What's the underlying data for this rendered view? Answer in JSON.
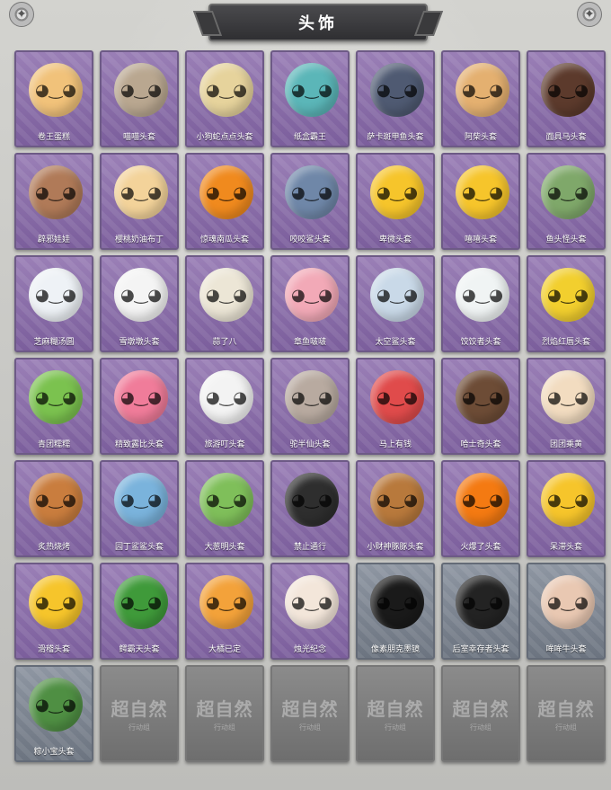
{
  "header": {
    "title": "头饰"
  },
  "icons": {
    "corner_left": "rune-icon",
    "corner_right": "rune-icon"
  },
  "items": [
    {
      "label": "卷王蛋糕",
      "icon": "cake-roll-icon",
      "color": "#f1c27a",
      "frame": "purple"
    },
    {
      "label": "喵喵头套",
      "icon": "cat-icon",
      "color": "#b9a790",
      "frame": "purple"
    },
    {
      "label": "小狗蛇点点头套",
      "icon": "snake-dog-icon",
      "color": "#e6d39c",
      "frame": "purple"
    },
    {
      "label": "纸盒霸王",
      "icon": "dino-box-icon",
      "color": "#5bb6b8",
      "frame": "purple"
    },
    {
      "label": "萨卡斑甲鱼头套",
      "icon": "fish-icon",
      "color": "#4f5a72",
      "frame": "purple"
    },
    {
      "label": "阿柴头套",
      "icon": "shiba-icon",
      "color": "#e4b070",
      "frame": "purple"
    },
    {
      "label": "面具马头套",
      "icon": "horse-icon",
      "color": "#5c3a2c",
      "frame": "purple"
    },
    {
      "label": "辟邪娃娃",
      "icon": "doll-icon",
      "color": "#b07a58",
      "frame": "purple"
    },
    {
      "label": "樱桃奶油布丁",
      "icon": "pudding-icon",
      "color": "#f3d39a",
      "frame": "purple"
    },
    {
      "label": "惊魂南瓜头套",
      "icon": "pumpkin-icon",
      "color": "#f08a1e",
      "frame": "purple"
    },
    {
      "label": "咬咬鲨头套",
      "icon": "shark-icon",
      "color": "#6f87a8",
      "frame": "purple"
    },
    {
      "label": "卑微头套",
      "icon": "emoji-icon",
      "color": "#f6c52b",
      "frame": "purple"
    },
    {
      "label": "嘻嘻头套",
      "icon": "emoji-grin-icon",
      "color": "#f6c52b",
      "frame": "purple"
    },
    {
      "label": "鱼头怪头套",
      "icon": "fishhead-icon",
      "color": "#7fa86a",
      "frame": "purple"
    },
    {
      "label": "芝麻糊汤圆",
      "icon": "dumpling-icon",
      "color": "#eef2f6",
      "frame": "purple"
    },
    {
      "label": "雪墩墩头套",
      "icon": "snowman-icon",
      "color": "#f4f4f4",
      "frame": "purple"
    },
    {
      "label": "蒜了八",
      "icon": "garlic-icon",
      "color": "#ece6d6",
      "frame": "purple"
    },
    {
      "label": "章鱼啵啵",
      "icon": "octopus-icon",
      "color": "#f2a9b7",
      "frame": "purple"
    },
    {
      "label": "太空鲨头套",
      "icon": "space-shark-icon",
      "color": "#c9d9e8",
      "frame": "purple"
    },
    {
      "label": "饺饺者头套",
      "icon": "cloud-icon",
      "color": "#f0f4f4",
      "frame": "purple"
    },
    {
      "label": "烈焰红唇头套",
      "icon": "pikachu-icon",
      "color": "#f2cf2e",
      "frame": "purple"
    },
    {
      "label": "青团糯糯",
      "icon": "qingtuan-icon",
      "color": "#7bc24f",
      "frame": "purple"
    },
    {
      "label": "精致露比头套",
      "icon": "ruby-icon",
      "color": "#f07c9a",
      "frame": "purple"
    },
    {
      "label": "旅游叮头套",
      "icon": "duck-icon",
      "color": "#f3f3f3",
      "frame": "purple"
    },
    {
      "label": "驼半仙头套",
      "icon": "raccoon-icon",
      "color": "#b8aaa0",
      "frame": "purple"
    },
    {
      "label": "马上有钱",
      "icon": "horse-red-icon",
      "color": "#e04b4b",
      "frame": "purple"
    },
    {
      "label": "哈士奇头套",
      "icon": "husky-icon",
      "color": "#6d4c36",
      "frame": "purple"
    },
    {
      "label": "团团乘黄",
      "icon": "hamster-icon",
      "color": "#f2dcc0",
      "frame": "purple"
    },
    {
      "label": "炙热烧烤",
      "icon": "bbq-icon",
      "color": "#c97d3e",
      "frame": "purple"
    },
    {
      "label": "园丁鲨鲨头套",
      "icon": "blue-shark-icon",
      "color": "#7ab3dc",
      "frame": "purple"
    },
    {
      "label": "大葱明头套",
      "icon": "scallion-icon",
      "color": "#7fbf5a",
      "frame": "purple"
    },
    {
      "label": "禁止通行",
      "icon": "traffic-cone-icon",
      "color": "#2e2e2e",
      "frame": "purple"
    },
    {
      "label": "小财神豚豚头套",
      "icon": "capybara-icon",
      "color": "#b8793c",
      "frame": "purple"
    },
    {
      "label": "火爆了头套",
      "icon": "fire-icon",
      "color": "#f47a12",
      "frame": "purple"
    },
    {
      "label": "呆滞头套",
      "icon": "dazed-emoji-icon",
      "color": "#f6c52b",
      "frame": "purple"
    },
    {
      "label": "滑稽头套",
      "icon": "funny-emoji-icon",
      "color": "#f6c52b",
      "frame": "purple"
    },
    {
      "label": "鳄霸天头套",
      "icon": "crocodile-icon",
      "color": "#3f9a3a",
      "frame": "purple"
    },
    {
      "label": "大橘已定",
      "icon": "orange-icon",
      "color": "#f3a23a",
      "frame": "purple"
    },
    {
      "label": "烛光纪念",
      "icon": "candle-icon",
      "color": "#f3e6da",
      "frame": "purple"
    },
    {
      "label": "像素朋克墨镜",
      "icon": "pixel-glasses-icon",
      "color": "#1a1a1a",
      "frame": "gray"
    },
    {
      "label": "后室幸存者头套",
      "icon": "gas-mask-icon",
      "color": "#232323",
      "frame": "gray"
    },
    {
      "label": "哞哞牛头套",
      "icon": "cow-icon",
      "color": "#e9c8b2",
      "frame": "gray"
    },
    {
      "label": "粽小宝头套",
      "icon": "zongzi-icon",
      "color": "#4f8f43",
      "frame": "gray"
    }
  ],
  "empty_slots": [
    {
      "watermark": "超自然",
      "sub": "行动组"
    },
    {
      "watermark": "超自然",
      "sub": "行动组"
    },
    {
      "watermark": "超自然",
      "sub": "行动组"
    },
    {
      "watermark": "超自然",
      "sub": "行动组"
    },
    {
      "watermark": "超自然",
      "sub": "行动组"
    },
    {
      "watermark": "超自然",
      "sub": "行动组"
    }
  ]
}
